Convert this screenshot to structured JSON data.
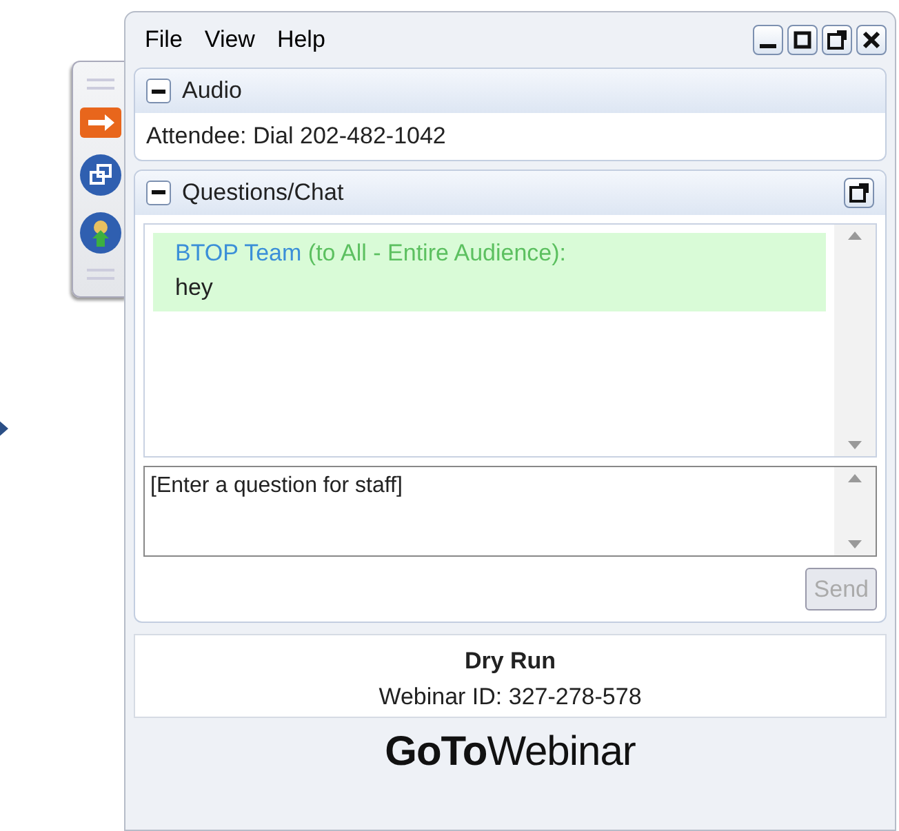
{
  "menu": [
    "File",
    "View",
    "Help"
  ],
  "window_buttons": [
    {
      "kind": "minimize"
    },
    {
      "kind": "maximize"
    },
    {
      "kind": "popout"
    },
    {
      "kind": "close"
    }
  ],
  "toolbar": [
    {
      "kind": "arrow"
    },
    {
      "kind": "windows"
    },
    {
      "kind": "raise-hand"
    }
  ],
  "audio": {
    "title": "Audio",
    "expanded": true,
    "text": "Attendee: Dial 202-482-1042"
  },
  "chat": {
    "title": "Questions/Chat",
    "expanded": true,
    "messages": [
      {
        "sender": "BTOP Team",
        "audience": "(to All - Entire Audience):",
        "text": "hey"
      }
    ],
    "input": {
      "placeholder": "[Enter a question for staff]"
    },
    "send": {
      "label": "Send",
      "disabled": true
    }
  },
  "webinar": {
    "title": "Dry Run",
    "id": "Webinar ID: 327-278-578"
  },
  "logo": "**GoTo**Webinar"
}
